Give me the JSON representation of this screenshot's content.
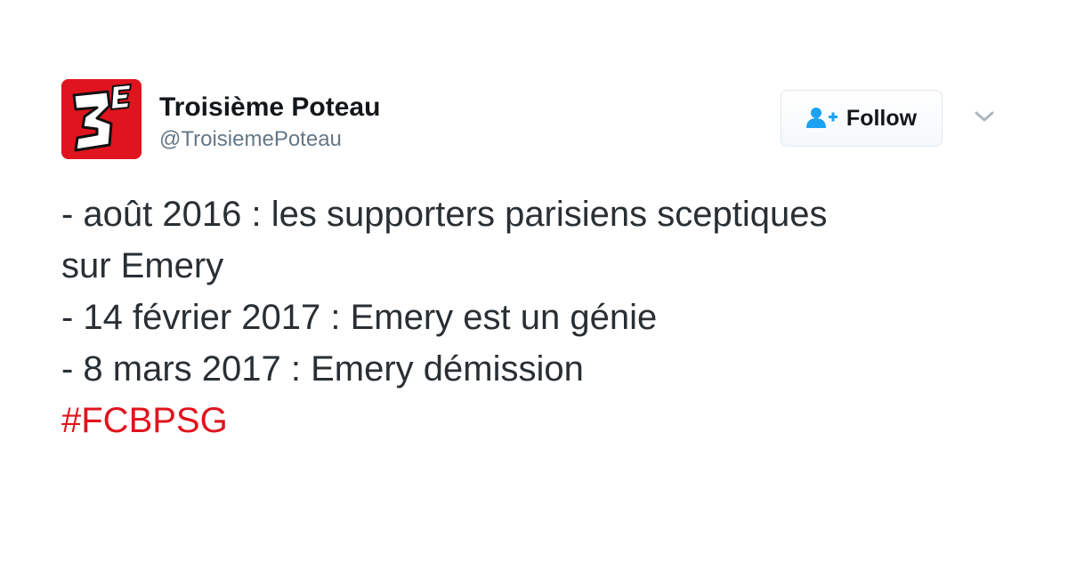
{
  "account": {
    "display_name": "Troisième Poteau",
    "handle": "@TroisiemePoteau",
    "avatar_label": "3E",
    "avatar_color": "#e0141e"
  },
  "follow_button": {
    "label": "Follow",
    "icon": "add-user-icon",
    "accent_color": "#1da1f2"
  },
  "menu": {
    "icon": "chevron-down-icon"
  },
  "tweet": {
    "lines": [
      "- août 2016 : les supporters parisiens sceptiques",
      "sur Emery",
      "- 14 février 2017 : Emery est un génie",
      "- 8 mars 2017 : Emery démission"
    ],
    "hashtag": "#FCBPSG",
    "hashtag_color": "#e0141e"
  }
}
